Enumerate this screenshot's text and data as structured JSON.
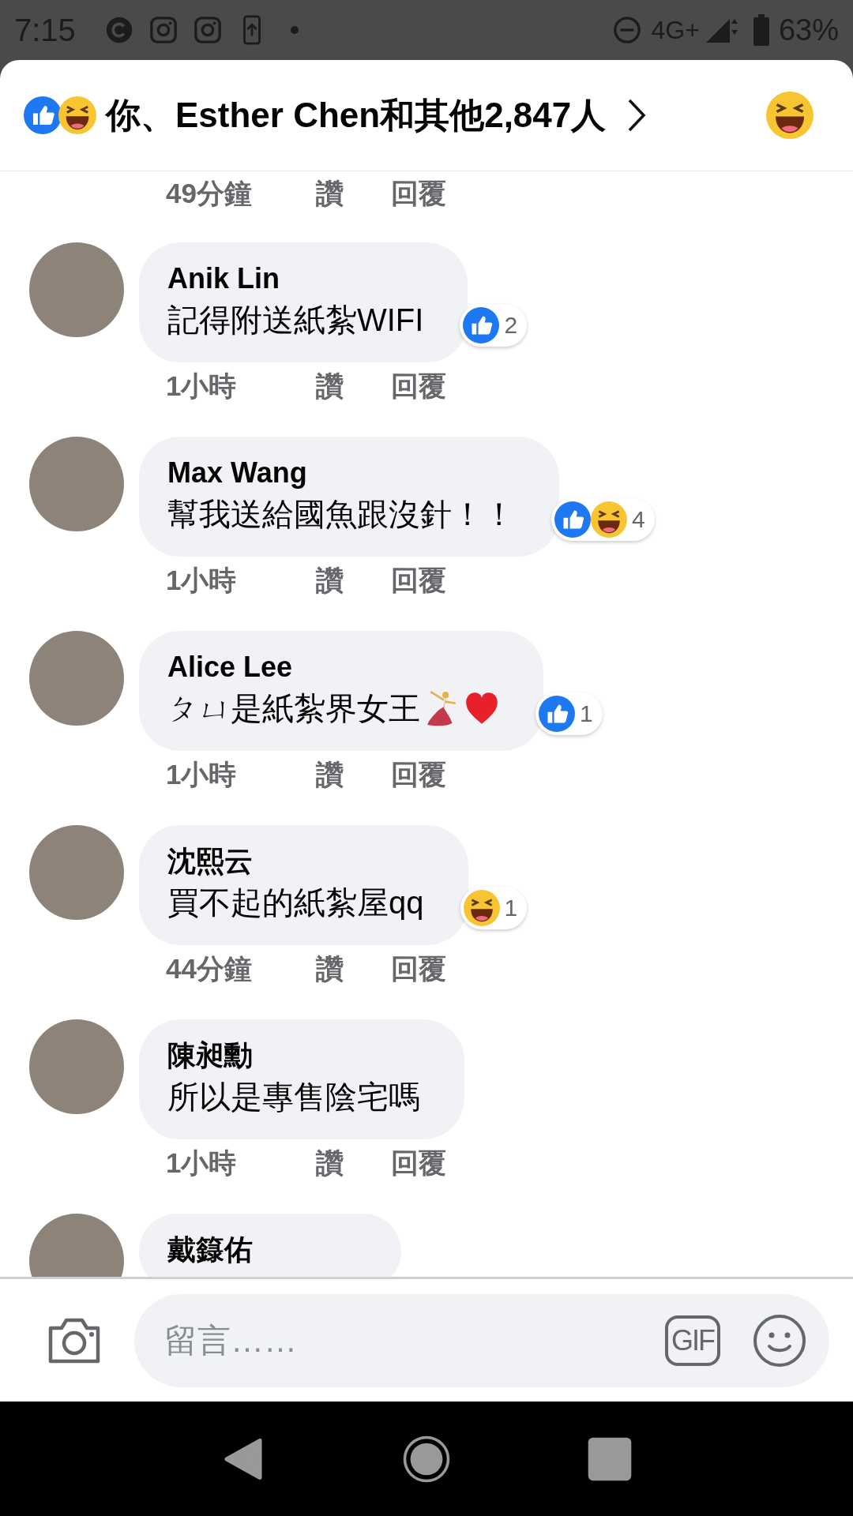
{
  "status_bar": {
    "time": "7:15",
    "network": "4G+",
    "battery": "63%"
  },
  "header": {
    "reactions": [
      {
        "kind": "like"
      },
      {
        "kind": "haha"
      }
    ],
    "summary": "你、Esther Chen和其他2,847人"
  },
  "earlier_meta": {
    "time": "49分鐘",
    "like": "讚",
    "reply": "回覆"
  },
  "comments": [
    {
      "name": "Anik Lin",
      "text": "記得附送紙紮WIFI",
      "emoji": false,
      "reactions": [
        {
          "kind": "like"
        }
      ],
      "count": "2",
      "time": "1小時",
      "like": "讚",
      "reply": "回覆"
    },
    {
      "name": "Max Wang",
      "text": "幫我送給國魚跟沒針！！",
      "emoji": false,
      "reactions": [
        {
          "kind": "like"
        },
        {
          "kind": "haha"
        }
      ],
      "count": "4",
      "time": "1小時",
      "like": "讚",
      "reply": "回覆"
    },
    {
      "name": "Alice Lee",
      "text": "ㄆㄩ是紙紮界女王",
      "emoji": true,
      "reactions": [
        {
          "kind": "like"
        }
      ],
      "count": "1",
      "time": "1小時",
      "like": "讚",
      "reply": "回覆"
    },
    {
      "name": "沈熙云",
      "text": "買不起的紙紮屋qq",
      "emoji": false,
      "reactions": [
        {
          "kind": "haha"
        }
      ],
      "count": "1",
      "time": "44分鐘",
      "like": "讚",
      "reply": "回覆"
    },
    {
      "name": "陳昶勳",
      "text": "所以是專售陰宅嗎",
      "emoji": false,
      "time": "1小時",
      "like": "讚",
      "reply": "回覆"
    },
    {
      "name": "戴籙佑"
    }
  ],
  "composer": {
    "placeholder": "留言……",
    "gif": "GIF"
  }
}
